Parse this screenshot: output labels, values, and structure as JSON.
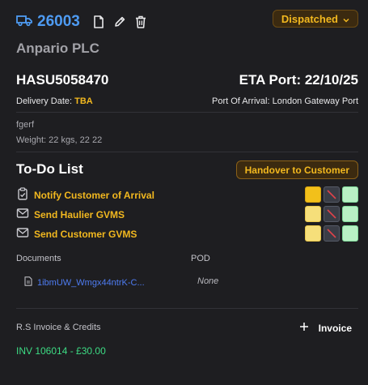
{
  "header": {
    "job_number": "26003",
    "truck_icon": "truck-icon",
    "actions": [
      "document-icon",
      "pencil-icon",
      "trash-icon"
    ],
    "status": "Dispatched"
  },
  "company": "Anpario PLC",
  "container": {
    "id": "HASU5058470",
    "eta": "ETA Port: 22/10/25",
    "delivery_label": "Delivery Date:",
    "delivery_value": "TBA",
    "port_label": "Port Of Arrival:",
    "port_value": "London Gateway Port"
  },
  "notes": {
    "text": "fgerf",
    "weight": "Weight: 22 kgs, 22 22"
  },
  "todo": {
    "title": "To-Do List",
    "handover_label": "Handover to Customer",
    "items": [
      {
        "label": "Notify Customer of Arrival",
        "icon": "clipboard-icon"
      },
      {
        "label": "Send Haulier GVMS",
        "icon": "mail-icon"
      },
      {
        "label": "Send Customer GVMS",
        "icon": "mail-icon"
      }
    ]
  },
  "documents": {
    "label": "Documents",
    "file": "1ibmUW_Wmgx44ntrK-C...",
    "pod_label": "POD",
    "pod_value": "None"
  },
  "invoice": {
    "label": "R.S Invoice & Credits",
    "button": "Invoice",
    "line": "INV 106014 - £30.00"
  },
  "colors": {
    "accent_blue": "#4e9bf2",
    "accent_amber": "#f2b81f",
    "success_green": "#3ddc84",
    "background": "#1e1e21"
  }
}
